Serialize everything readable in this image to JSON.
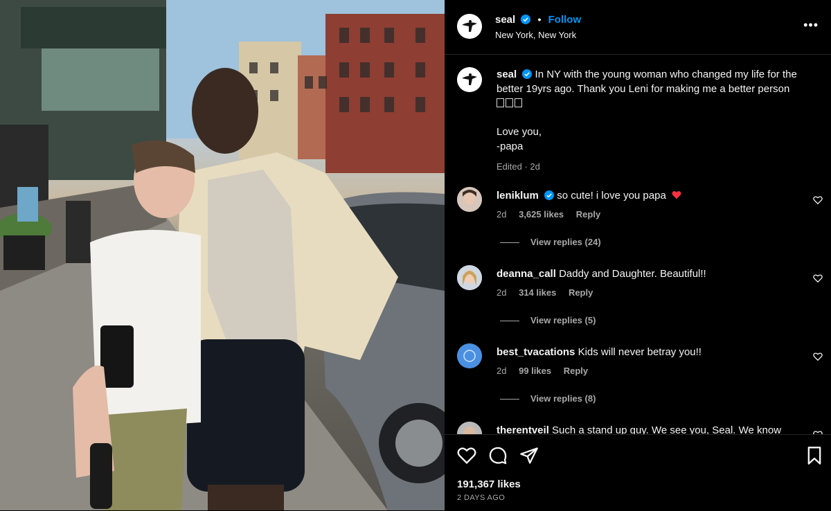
{
  "post": {
    "username": "seal",
    "follow_label": "Follow",
    "location": "New York, New York",
    "more_label": "•••",
    "caption_text": "In NY with the young woman who changed my life for the better 19yrs ago. Thank you Leni for making me a better person",
    "caption_line2": "Love you,",
    "caption_line3": "-papa",
    "caption_meta": "Edited · 2d"
  },
  "comments": [
    {
      "user": "leniklum",
      "text": "so cute! i love you papa",
      "time": "2d",
      "likes": "3,625 likes",
      "reply": "Reply",
      "replies": "View replies (24)"
    },
    {
      "user": "deanna_call",
      "text": "Daddy and Daughter. Beautiful!!",
      "time": "2d",
      "likes": "314 likes",
      "reply": "Reply",
      "replies": "View replies (5)"
    },
    {
      "user": "best_tvacations",
      "text": "Kids will never betray you!!",
      "time": "2d",
      "likes": "99 likes",
      "reply": "Reply",
      "replies": "View replies (8)"
    },
    {
      "user": "therentveil",
      "text": "Such a stand up guy. We see you, Seal. We know"
    }
  ],
  "footer": {
    "likes": "191,367 likes",
    "time_ago": "2 DAYS AGO"
  },
  "colors": {
    "accent": "#0095f6",
    "background": "#000000",
    "muted": "#a8a8a8",
    "heart": "#ff3040"
  },
  "icons": [
    "heart-icon",
    "comment-icon",
    "share-icon",
    "bookmark-icon",
    "verified-icon",
    "more-icon"
  ]
}
